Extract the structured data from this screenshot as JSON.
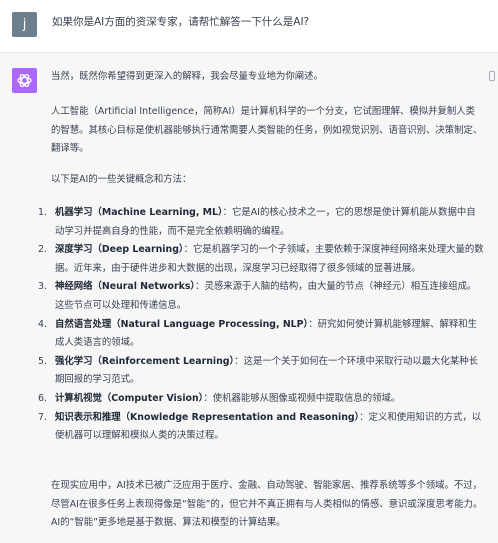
{
  "user": {
    "avatar_letter": "j",
    "message": "如果你是AI方面的资深专家，请帮忙解答一下什么是AI?"
  },
  "assistant": {
    "intro": "当然，既然你希望得到更深入的解释，我会尽量专业地为你阐述。",
    "para1": "人工智能（Artificial Intelligence，简称AI）是计算机科学的一个分支，它试图理解、模拟并复制人类的智慧。其核心目标是使机器能够执行通常需要人类智能的任务，例如视觉识别、语音识别、决策制定、翻译等。",
    "list_intro": "以下是AI的一些关键概念和方法：",
    "concepts": [
      {
        "num": "1.",
        "term": "机器学习（Machine Learning, ML）",
        "desc": "：它是AI的核心技术之一，它的思想是使计算机能从数据中自动学习并提高自身的性能，而不是完全依赖明确的编程。"
      },
      {
        "num": "2.",
        "term": "深度学习（Deep Learning）",
        "desc": "：它是机器学习的一个子领域，主要依赖于深度神经网络来处理大量的数据。近年来，由于硬件进步和大数据的出现，深度学习已经取得了很多领域的显著进展。"
      },
      {
        "num": "3.",
        "term": "神经网络（Neural Networks）",
        "desc": "：灵感来源于人脑的结构，由大量的节点（神经元）相互连接组成。这些节点可以处理和传递信息。"
      },
      {
        "num": "4.",
        "term": "自然语言处理（Natural Language Processing, NLP）",
        "desc": "：研究如何使计算机能够理解、解释和生成人类语言的领域。"
      },
      {
        "num": "5.",
        "term": "强化学习（Reinforcement Learning）",
        "desc": "：这是一个关于如何在一个环境中采取行动以最大化某种长期回报的学习范式。"
      },
      {
        "num": "6.",
        "term": "计算机视觉（Computer Vision）",
        "desc": "：使机器能够从图像或视频中提取信息的领域。"
      },
      {
        "num": "7.",
        "term": "知识表示和推理（Knowledge Representation and Reasoning）",
        "desc": "：定义和使用知识的方式，以便机器可以理解和模拟人类的决策过程。"
      }
    ],
    "closing": "在现实应用中，AI技术已被广泛应用于医疗、金融、自动驾驶、智能家居、推荐系统等多个领域。不过，尽管AI在很多任务上表现得像是“智能”的，但它并不真正拥有与人类相似的情感、意识或深度思考能力。AI的“智能”更多地是基于数据、算法和模型的计算结果。"
  },
  "colors": {
    "gpt_avatar": "#ab68ff",
    "user_avatar": "#6b7f8d",
    "assistant_bg": "#f7f7f8"
  }
}
